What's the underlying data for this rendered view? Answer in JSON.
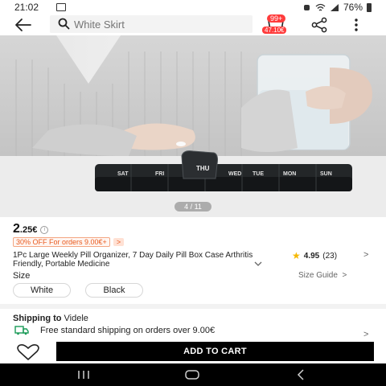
{
  "status_bar": {
    "time": "21:02",
    "battery": "76%"
  },
  "header": {
    "search_placeholder": "White Skirt",
    "cart_badge": "99+",
    "cart_price_badge": "47.10€"
  },
  "gallery": {
    "counter": "4 / 11"
  },
  "product": {
    "price_main": "2",
    "price_cents": ".25€",
    "promo": "30% OFF For orders 9.00€+",
    "promo_arrow": ">",
    "title": "1Pc Large Weekly Pill Organizer, 7 Day Daily Pill Box Case Arthritis Friendly,  Portable Medicine",
    "rating_score": "4.95",
    "rating_count": "(23)",
    "pill_days": [
      "SAT",
      "FRI",
      "THU",
      "WED",
      "TUE",
      "MON",
      "SUN"
    ]
  },
  "size": {
    "label": "Size",
    "guide": "Size Guide",
    "options": [
      "White",
      "Black"
    ]
  },
  "shipping": {
    "title_bold": "Shipping to",
    "destination": "Videle",
    "free_text": "Free standard shipping on orders over 9.00€"
  },
  "actions": {
    "add_to_cart": "ADD TO CART"
  },
  "colors": {
    "accent": "#ff3b3b",
    "promo": "#e85a1e",
    "star": "#f5b800",
    "shipping_icon": "#1a9a57"
  }
}
